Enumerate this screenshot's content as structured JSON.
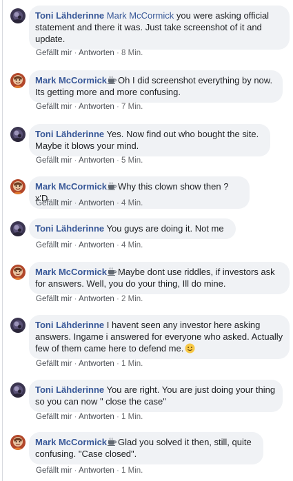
{
  "labels": {
    "like": "Gefällt mir",
    "reply": "Antworten",
    "separator": "·"
  },
  "comments": [
    {
      "author": "Toni Lähderinne",
      "author_badge": "",
      "mention": "Mark McCormick",
      "text_lines": [
        "you were asking official",
        "statement and there it was. Just take screenshot of it and",
        "update."
      ],
      "time": "8 Min."
    },
    {
      "author": "Mark McCormick",
      "author_badge": "coffee-cup-icon",
      "mention": "",
      "text_lines": [
        "Oh I did screenshot everything by now.",
        "Its getting more and more confusing."
      ],
      "time": "7 Min."
    },
    {
      "author": "Toni Lähderinne",
      "author_badge": "",
      "mention": "",
      "text_lines": [
        "Yes. Now find out who bought the site.",
        "Maybe it blows your mind."
      ],
      "time": "5 Min."
    },
    {
      "author": "Mark McCormick",
      "author_badge": "coffee-cup-icon",
      "mention": "",
      "text_lines": [
        "Why this clown show then ? x'D"
      ],
      "time": "4 Min."
    },
    {
      "author": "Toni Lähderinne",
      "author_badge": "",
      "mention": "",
      "text_lines": [
        "You guys are doing it. Not me"
      ],
      "time": "4 Min."
    },
    {
      "author": "Mark McCormick",
      "author_badge": "coffee-cup-icon",
      "mention": "",
      "text_lines": [
        "Maybe dont use riddles, if investors ask",
        "for answers. Well, you do your thing, Ill do mine."
      ],
      "time": "2 Min."
    },
    {
      "author": "Toni Lähderinne",
      "author_badge": "",
      "mention": "",
      "text_lines": [
        "I havent seen any investor here asking",
        "answers. Ingame i answered for everyone who asked. Actually",
        "few of them came here to defend me."
      ],
      "trailing_emoji": "smiling-face-icon",
      "time": "1 Min."
    },
    {
      "author": "Toni Lähderinne",
      "author_badge": "",
      "mention": "",
      "text_lines": [
        "You are right. You are just doing your thing",
        "so you can now \" close the case\""
      ],
      "time": "1 Min."
    },
    {
      "author": "Mark McCormick",
      "author_badge": "coffee-cup-icon",
      "mention": "",
      "text_lines": [
        "Glad you solved it then, still, quite",
        "confusing. \"Case closed\"."
      ],
      "time": "1 Min."
    }
  ],
  "colors": {
    "author_link": "#385898",
    "bubble_bg": "#f0f2f5",
    "meta_text": "#65676b"
  }
}
